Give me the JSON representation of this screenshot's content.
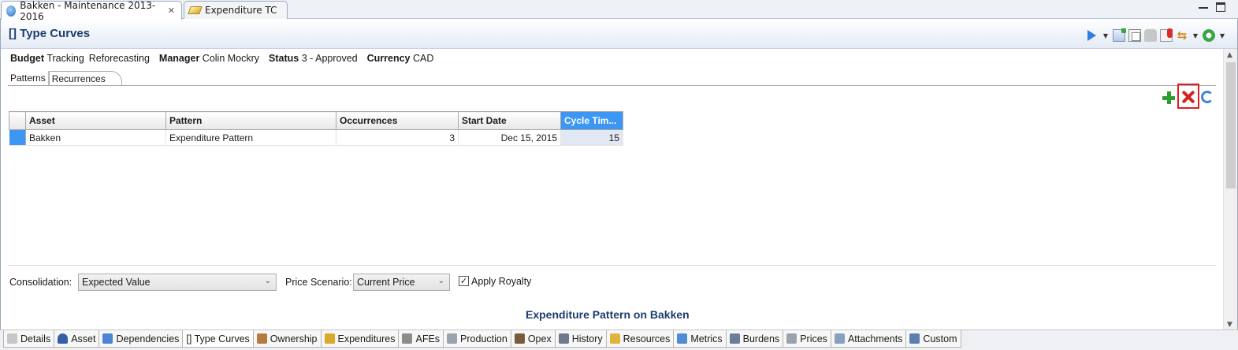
{
  "editor_tabs": [
    {
      "label": "Bakken - Maintenance 2013-2016",
      "icon": "globe-icon",
      "active": true
    },
    {
      "label": "Expenditure TC",
      "icon": "coin-icon",
      "active": false
    }
  ],
  "header": {
    "title": "[] Type Curves"
  },
  "info": {
    "budget_label": "Budget",
    "budget_value": "Tracking",
    "budget_value2": "Reforecasting",
    "manager_label": "Manager",
    "manager_value": "Colin Mockry",
    "status_label": "Status",
    "status_value": "3 - Approved",
    "currency_label": "Currency",
    "currency_value": "CAD"
  },
  "subtabs": [
    {
      "label": "Patterns",
      "active": false
    },
    {
      "label": "Recurrences",
      "active": true
    }
  ],
  "table": {
    "columns": [
      "Asset",
      "Pattern",
      "Occurrences",
      "Start Date",
      "Cycle Tim..."
    ],
    "rows": [
      {
        "asset": "Bakken",
        "pattern": "Expenditure Pattern",
        "occurrences": "3",
        "start_date": "Dec 15, 2015",
        "cycle_time": "15"
      }
    ]
  },
  "controls": {
    "consolidation_label": "Consolidation:",
    "consolidation_value": "Expected Value",
    "price_label": "Price Scenario:",
    "price_value": "Current Price",
    "royalty_label": "Apply Royalty",
    "royalty_checked": true,
    "check_mark": "✓"
  },
  "section_title": "Expenditure Pattern on Bakken",
  "bottom_tabs": [
    {
      "label": "Details",
      "icon": "details-icon",
      "color": "#c7c7c7"
    },
    {
      "label": "Asset",
      "icon": "person-icon",
      "color": "#3560a8"
    },
    {
      "label": "Dependencies",
      "icon": "dependencies-icon",
      "color": "#4a86d4"
    },
    {
      "label": "[] Type Curves",
      "icon": "",
      "color": "",
      "active": true
    },
    {
      "label": "Ownership",
      "icon": "handshake-icon",
      "color": "#b57a3c"
    },
    {
      "label": "Expenditures",
      "icon": "coin-icon",
      "color": "#d9a92b"
    },
    {
      "label": "AFEs",
      "icon": "afe-icon",
      "color": "#8c8c8c"
    },
    {
      "label": "Production",
      "icon": "barrel-icon",
      "color": "#9aa3ad"
    },
    {
      "label": "Opex",
      "icon": "opex-icon",
      "color": "#7a5a3c"
    },
    {
      "label": "History",
      "icon": "history-icon",
      "color": "#6e7a8a"
    },
    {
      "label": "Resources",
      "icon": "resources-icon",
      "color": "#e0b43c"
    },
    {
      "label": "Metrics",
      "icon": "metrics-icon",
      "color": "#4f8cd6"
    },
    {
      "label": "Burdens",
      "icon": "burdens-icon",
      "color": "#6a7d99"
    },
    {
      "label": "Prices",
      "icon": "prices-icon",
      "color": "#9aa3ad"
    },
    {
      "label": "Attachments",
      "icon": "attachments-icon",
      "color": "#8aa0c0"
    },
    {
      "label": "Custom",
      "icon": "custom-icon",
      "color": "#5c7fb0"
    }
  ]
}
